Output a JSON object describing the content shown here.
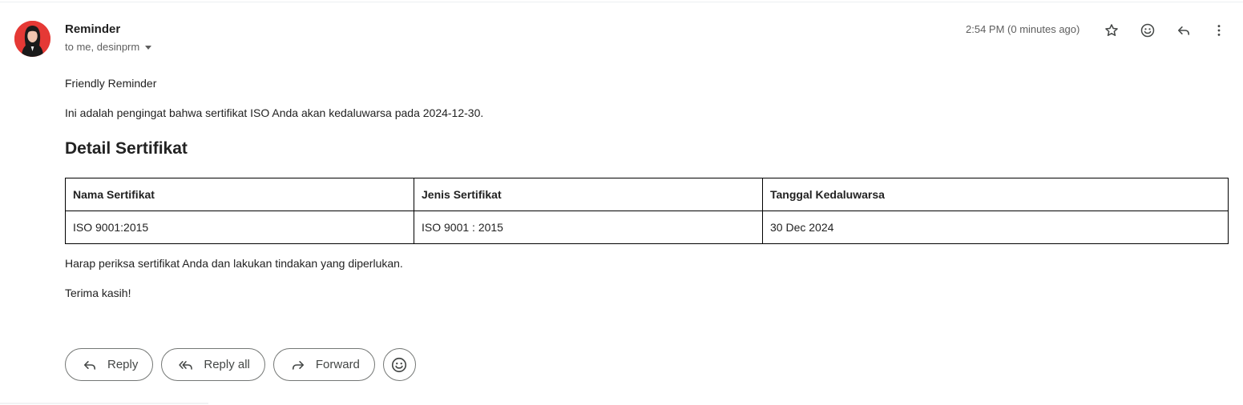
{
  "email": {
    "sender": "Reminder",
    "recipients": "to me, desinprm",
    "timestamp": "2:54 PM (0 minutes ago)"
  },
  "header_icons": [
    "star-icon",
    "emoji-icon",
    "reply-icon",
    "more-vert-icon"
  ],
  "body": {
    "greeting": "Friendly Reminder",
    "intro": "Ini adalah pengingat bahwa sertifikat ISO Anda akan kedaluwarsa pada 2024-12-30.",
    "heading": "Detail Sertifikat",
    "table": {
      "headers": [
        "Nama Sertifikat",
        "Jenis Sertifikat",
        "Tanggal Kedaluwarsa"
      ],
      "rows": [
        [
          "ISO 9001:2015",
          "ISO 9001 : 2015",
          "30 Dec 2024"
        ]
      ]
    },
    "closing": "Harap periksa sertifikat Anda dan lakukan tindakan yang diperlukan.",
    "thanks": "Terima kasih!"
  },
  "actions": {
    "reply": "Reply",
    "reply_all": "Reply all",
    "forward": "Forward"
  },
  "colors": {
    "avatar_bg": "#e53935",
    "border": "#747775",
    "muted_text": "#5e5e5e"
  }
}
